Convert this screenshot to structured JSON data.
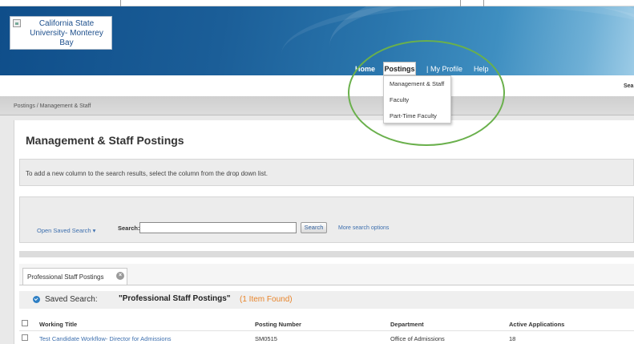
{
  "header": {
    "logo_alt": "California State University- Monterey Bay",
    "nav": {
      "home": "Home",
      "postings": "Postings",
      "separator": "|",
      "my_profile": "My Profile",
      "help": "Help"
    },
    "postings_menu": [
      "Management & Staff",
      "Faculty",
      "Part-Time Faculty"
    ],
    "search_truncated": "Sea"
  },
  "breadcrumb": "Postings  /  Management & Staff",
  "page": {
    "title": "Management & Staff Postings",
    "info_text": "To add a new column to the search results, select the column from the drop down list."
  },
  "search": {
    "open_saved": "Open Saved Search ▾",
    "label": "Search:",
    "value": "",
    "button": "Search",
    "more_options": "More search options"
  },
  "tabs": [
    {
      "label": "Professional Staff Postings",
      "close": "×"
    }
  ],
  "saved_search": {
    "prefix": "Saved Search: ",
    "name": "\"Professional Staff Postings\"",
    "count": "(1 Item Found)"
  },
  "table": {
    "columns": [
      "Working Title",
      "Posting Number",
      "Department",
      "Active Applications"
    ],
    "rows": [
      [
        "Test Candidate Workflow- Director for Admissions",
        "SM0515",
        "Office of Admissions",
        "18"
      ]
    ]
  },
  "colors": {
    "banner": "#1b5e98",
    "highlight_ellipse": "#6ab04c",
    "link": "#3d6fae",
    "count": "#e8842a"
  }
}
